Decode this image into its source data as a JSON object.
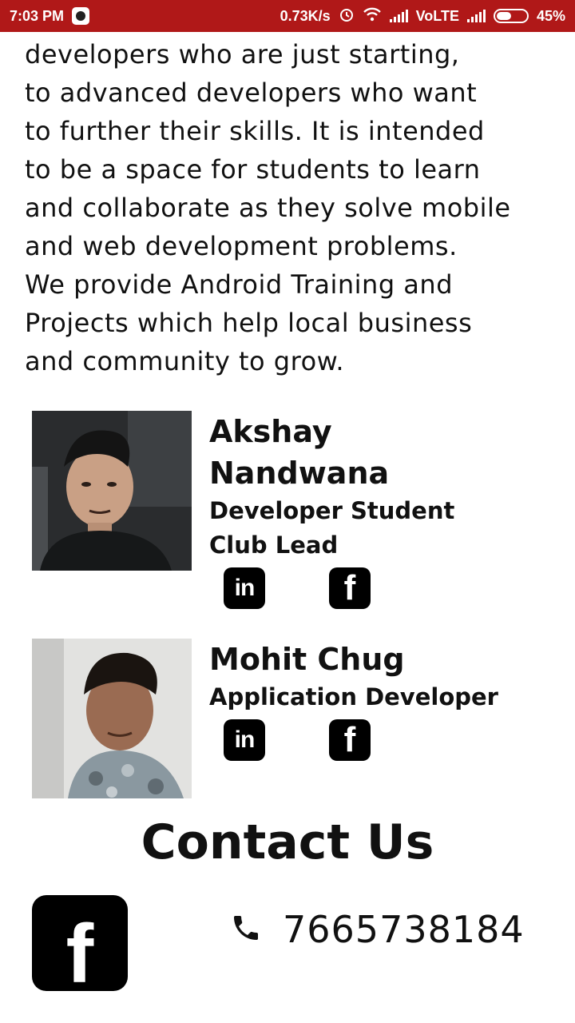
{
  "status_bar": {
    "time": "7:03 PM",
    "speed": "0.73K/s",
    "network": "VoLTE",
    "battery": "45%"
  },
  "about": {
    "lines": [
      "developers who are just starting,",
      "to advanced developers who want",
      "to further their skills. It is intended",
      "to be a space for students to learn",
      "and collaborate as they solve mobile",
      "and web development problems.",
      "We provide Android Training and",
      "Projects which help local business",
      "and community to grow."
    ]
  },
  "members": [
    {
      "name_lines": [
        "Akshay",
        "Nandwana"
      ],
      "role_lines": [
        "Developer Student",
        "Club Lead"
      ],
      "linkedin_icon": "linkedin-icon",
      "facebook_icon": "facebook-icon"
    },
    {
      "name_lines": [
        "Mohit Chug"
      ],
      "role_lines": [
        "Application Developer"
      ],
      "linkedin_icon": "linkedin-icon",
      "facebook_icon": "facebook-icon"
    }
  ],
  "contact": {
    "title": "Contact Us",
    "phone": "7665738184",
    "phone_icon": "phone-icon",
    "facebook_icon": "facebook-icon"
  },
  "colors": {
    "status_bar": "#b01818",
    "text": "#111111",
    "icon_bg": "#000000"
  }
}
